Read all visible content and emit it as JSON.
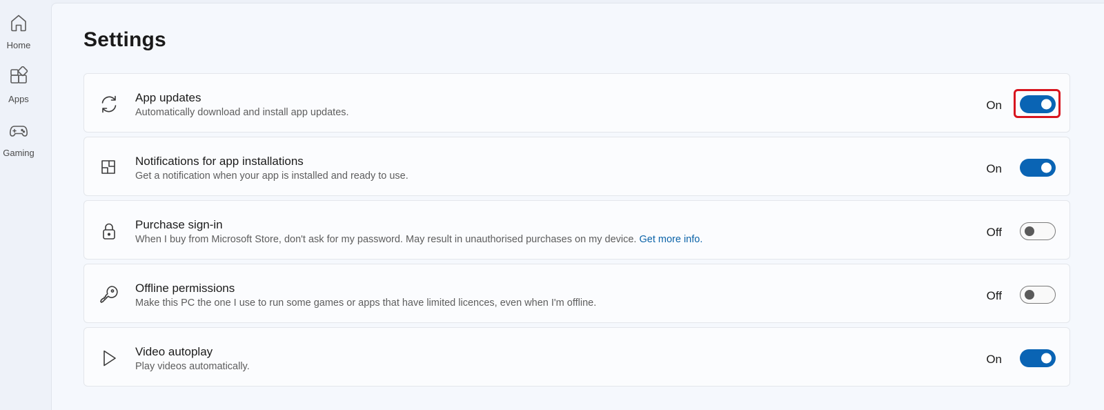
{
  "nav": {
    "items": [
      {
        "label": "Home",
        "icon": "home-icon"
      },
      {
        "label": "Apps",
        "icon": "apps-icon"
      },
      {
        "label": "Gaming",
        "icon": "gamepad-icon"
      }
    ]
  },
  "page": {
    "title": "Settings"
  },
  "settings": [
    {
      "title": "App updates",
      "description": "Automatically download and install app updates.",
      "state": "On",
      "on": true,
      "icon": "sync-icon"
    },
    {
      "title": "Notifications for app installations",
      "description": "Get a notification when your app is installed and ready to use.",
      "state": "On",
      "on": true,
      "icon": "notification-grid-icon"
    },
    {
      "title": "Purchase sign-in",
      "description": "When I buy from Microsoft Store, don't ask for my password. May result in unauthorised purchases on my device.",
      "link": "Get more info.",
      "state": "Off",
      "on": false,
      "icon": "lock-icon"
    },
    {
      "title": "Offline permissions",
      "description": "Make this PC the one I use to run some games or apps that have limited licences, even when I'm offline.",
      "state": "Off",
      "on": false,
      "icon": "key-icon"
    },
    {
      "title": "Video autoplay",
      "description": "Play videos automatically.",
      "state": "On",
      "on": true,
      "icon": "play-icon"
    }
  ],
  "colors": {
    "accent": "#0a64b4",
    "highlight": "#d8141e",
    "link": "#0b63a8"
  }
}
